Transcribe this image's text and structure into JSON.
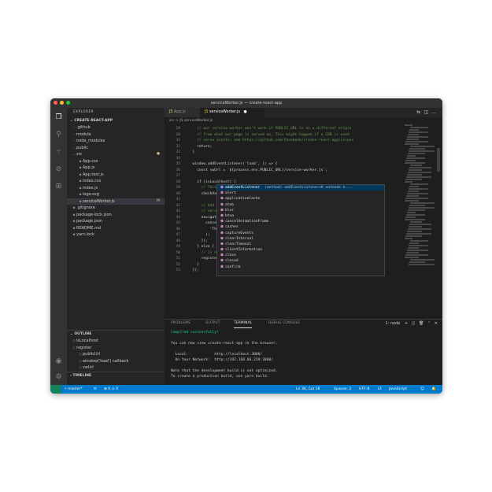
{
  "window": {
    "title": "serviceWorker.js — create-react-app"
  },
  "sidebar": {
    "header": "EXPLORER",
    "project": "CREATE-REACT-APP",
    "items": [
      {
        "label": ".github",
        "icon": "folder"
      },
      {
        "label": "module",
        "icon": "folder"
      },
      {
        "label": "node_modules",
        "icon": "folder"
      },
      {
        "label": "public",
        "icon": "folder"
      },
      {
        "label": "src",
        "icon": "folder-open",
        "badge": "●"
      },
      {
        "label": "App.css",
        "icon": "file"
      },
      {
        "label": "App.js",
        "icon": "file"
      },
      {
        "label": "App.test.js",
        "icon": "file"
      },
      {
        "label": "index.css",
        "icon": "file"
      },
      {
        "label": "index.js",
        "icon": "file"
      },
      {
        "label": "logo.svg",
        "icon": "file"
      },
      {
        "label": "serviceWorker.js",
        "icon": "file",
        "badge": "M",
        "selected": true
      },
      {
        "label": ".gitignore",
        "icon": "file"
      },
      {
        "label": "package-lock.json",
        "icon": "file"
      },
      {
        "label": "package.json",
        "icon": "file"
      },
      {
        "label": "README.md",
        "icon": "file"
      },
      {
        "label": "yarn.lock",
        "icon": "file"
      }
    ],
    "outline": {
      "header": "OUTLINE",
      "items": [
        {
          "label": "isLocalhost"
        },
        {
          "label": "register"
        },
        {
          "label": "publicUrl"
        },
        {
          "label": "window('load') callback"
        },
        {
          "label": "swUrl"
        }
      ],
      "timeline": "TIMELINE"
    }
  },
  "editor": {
    "tabs": [
      {
        "label": "App.js"
      },
      {
        "label": "serviceWorker.js",
        "active": true
      }
    ],
    "breadcrumb": "src > JS serviceWorker.js",
    "lines": [
      {
        "n": "29",
        "t": "    // our service worker won't work if PUBLIC_URL is on a different origin"
      },
      {
        "n": "30",
        "t": "    // from what our page is served on. This might happen if a CDN is used"
      },
      {
        "n": "31",
        "t": "    // serve assets; see https://github.com/facebook/create-react-app/issues"
      },
      {
        "n": "32",
        "t": "    return;"
      },
      {
        "n": "33",
        "t": "  }"
      },
      {
        "n": "34",
        "t": ""
      },
      {
        "n": "35",
        "t": "  window.addEventListener('load', () => {"
      },
      {
        "n": "36",
        "t": "    const swUrl = `${process.env.PUBLIC_URL}/service-worker.js`;"
      },
      {
        "n": "37",
        "t": ""
      },
      {
        "n": "38",
        "t": "    if (isLocalhost) {"
      },
      {
        "n": "39",
        "t": "      // This is running on localhost."
      },
      {
        "n": "40",
        "t": "      checkValidServiceWorker(swUrl, config);"
      },
      {
        "n": "41",
        "t": ""
      },
      {
        "n": "42",
        "t": "      // Add some additional logging to localhost"
      },
      {
        "n": "43",
        "t": "      // service worker/PWA documentation."
      },
      {
        "n": "44",
        "t": "      navigator.serviceWorker.ready.then(() => {"
      },
      {
        "n": "45",
        "t": "        console.log("
      },
      {
        "n": "46",
        "t": "          'This web app is being served cache-first'"
      },
      {
        "n": "47",
        "t": "        );"
      },
      {
        "n": "48",
        "t": "      });"
      },
      {
        "n": "49",
        "t": "    } else {"
      },
      {
        "n": "50",
        "t": "      // Is not localhost. Just register service worker"
      },
      {
        "n": "51",
        "t": "      registerValidSW(swUrl, config);"
      },
      {
        "n": "52",
        "t": "    }"
      },
      {
        "n": "53",
        "t": "  });"
      }
    ],
    "suggestions": [
      {
        "label": "addEventListener",
        "detail": "(method) addEventListener<K extends k...",
        "selected": true
      },
      {
        "label": "alert"
      },
      {
        "label": "applicationCache"
      },
      {
        "label": "atob"
      },
      {
        "label": "blur"
      },
      {
        "label": "btoa"
      },
      {
        "label": "cancelAnimationFrame"
      },
      {
        "label": "caches"
      },
      {
        "label": "captureEvents"
      },
      {
        "label": "clearInterval"
      },
      {
        "label": "clearTimeout"
      },
      {
        "label": "clientInformation"
      },
      {
        "label": "close"
      },
      {
        "label": "closed"
      },
      {
        "label": "confirm"
      }
    ]
  },
  "panel": {
    "tabs": [
      "PROBLEMS",
      "OUTPUT",
      "TERMINAL",
      "DEBUG CONSOLE"
    ],
    "active_tab": "TERMINAL",
    "shell": "1: node",
    "terminal": [
      "Compiled successfully!",
      "",
      "You can now view create-react-app in the browser.",
      "",
      "  Local:            http://localhost:3000/",
      "  On Your Network:  http://192.168.86.219:3000/",
      "",
      "Note that the development build is not optimized.",
      "To create a production build, use yarn build.",
      "",
      ">"
    ]
  },
  "statusbar": {
    "branch": "master*",
    "sync": "⟳",
    "problems": "⊗ 0 ⚠ 0",
    "position": "Ln 36, Col 18",
    "spaces": "Spaces: 2",
    "encoding": "UTF-8",
    "eol": "LF",
    "language": "JavaScript",
    "feedback": "☺",
    "bell": "🔔"
  }
}
